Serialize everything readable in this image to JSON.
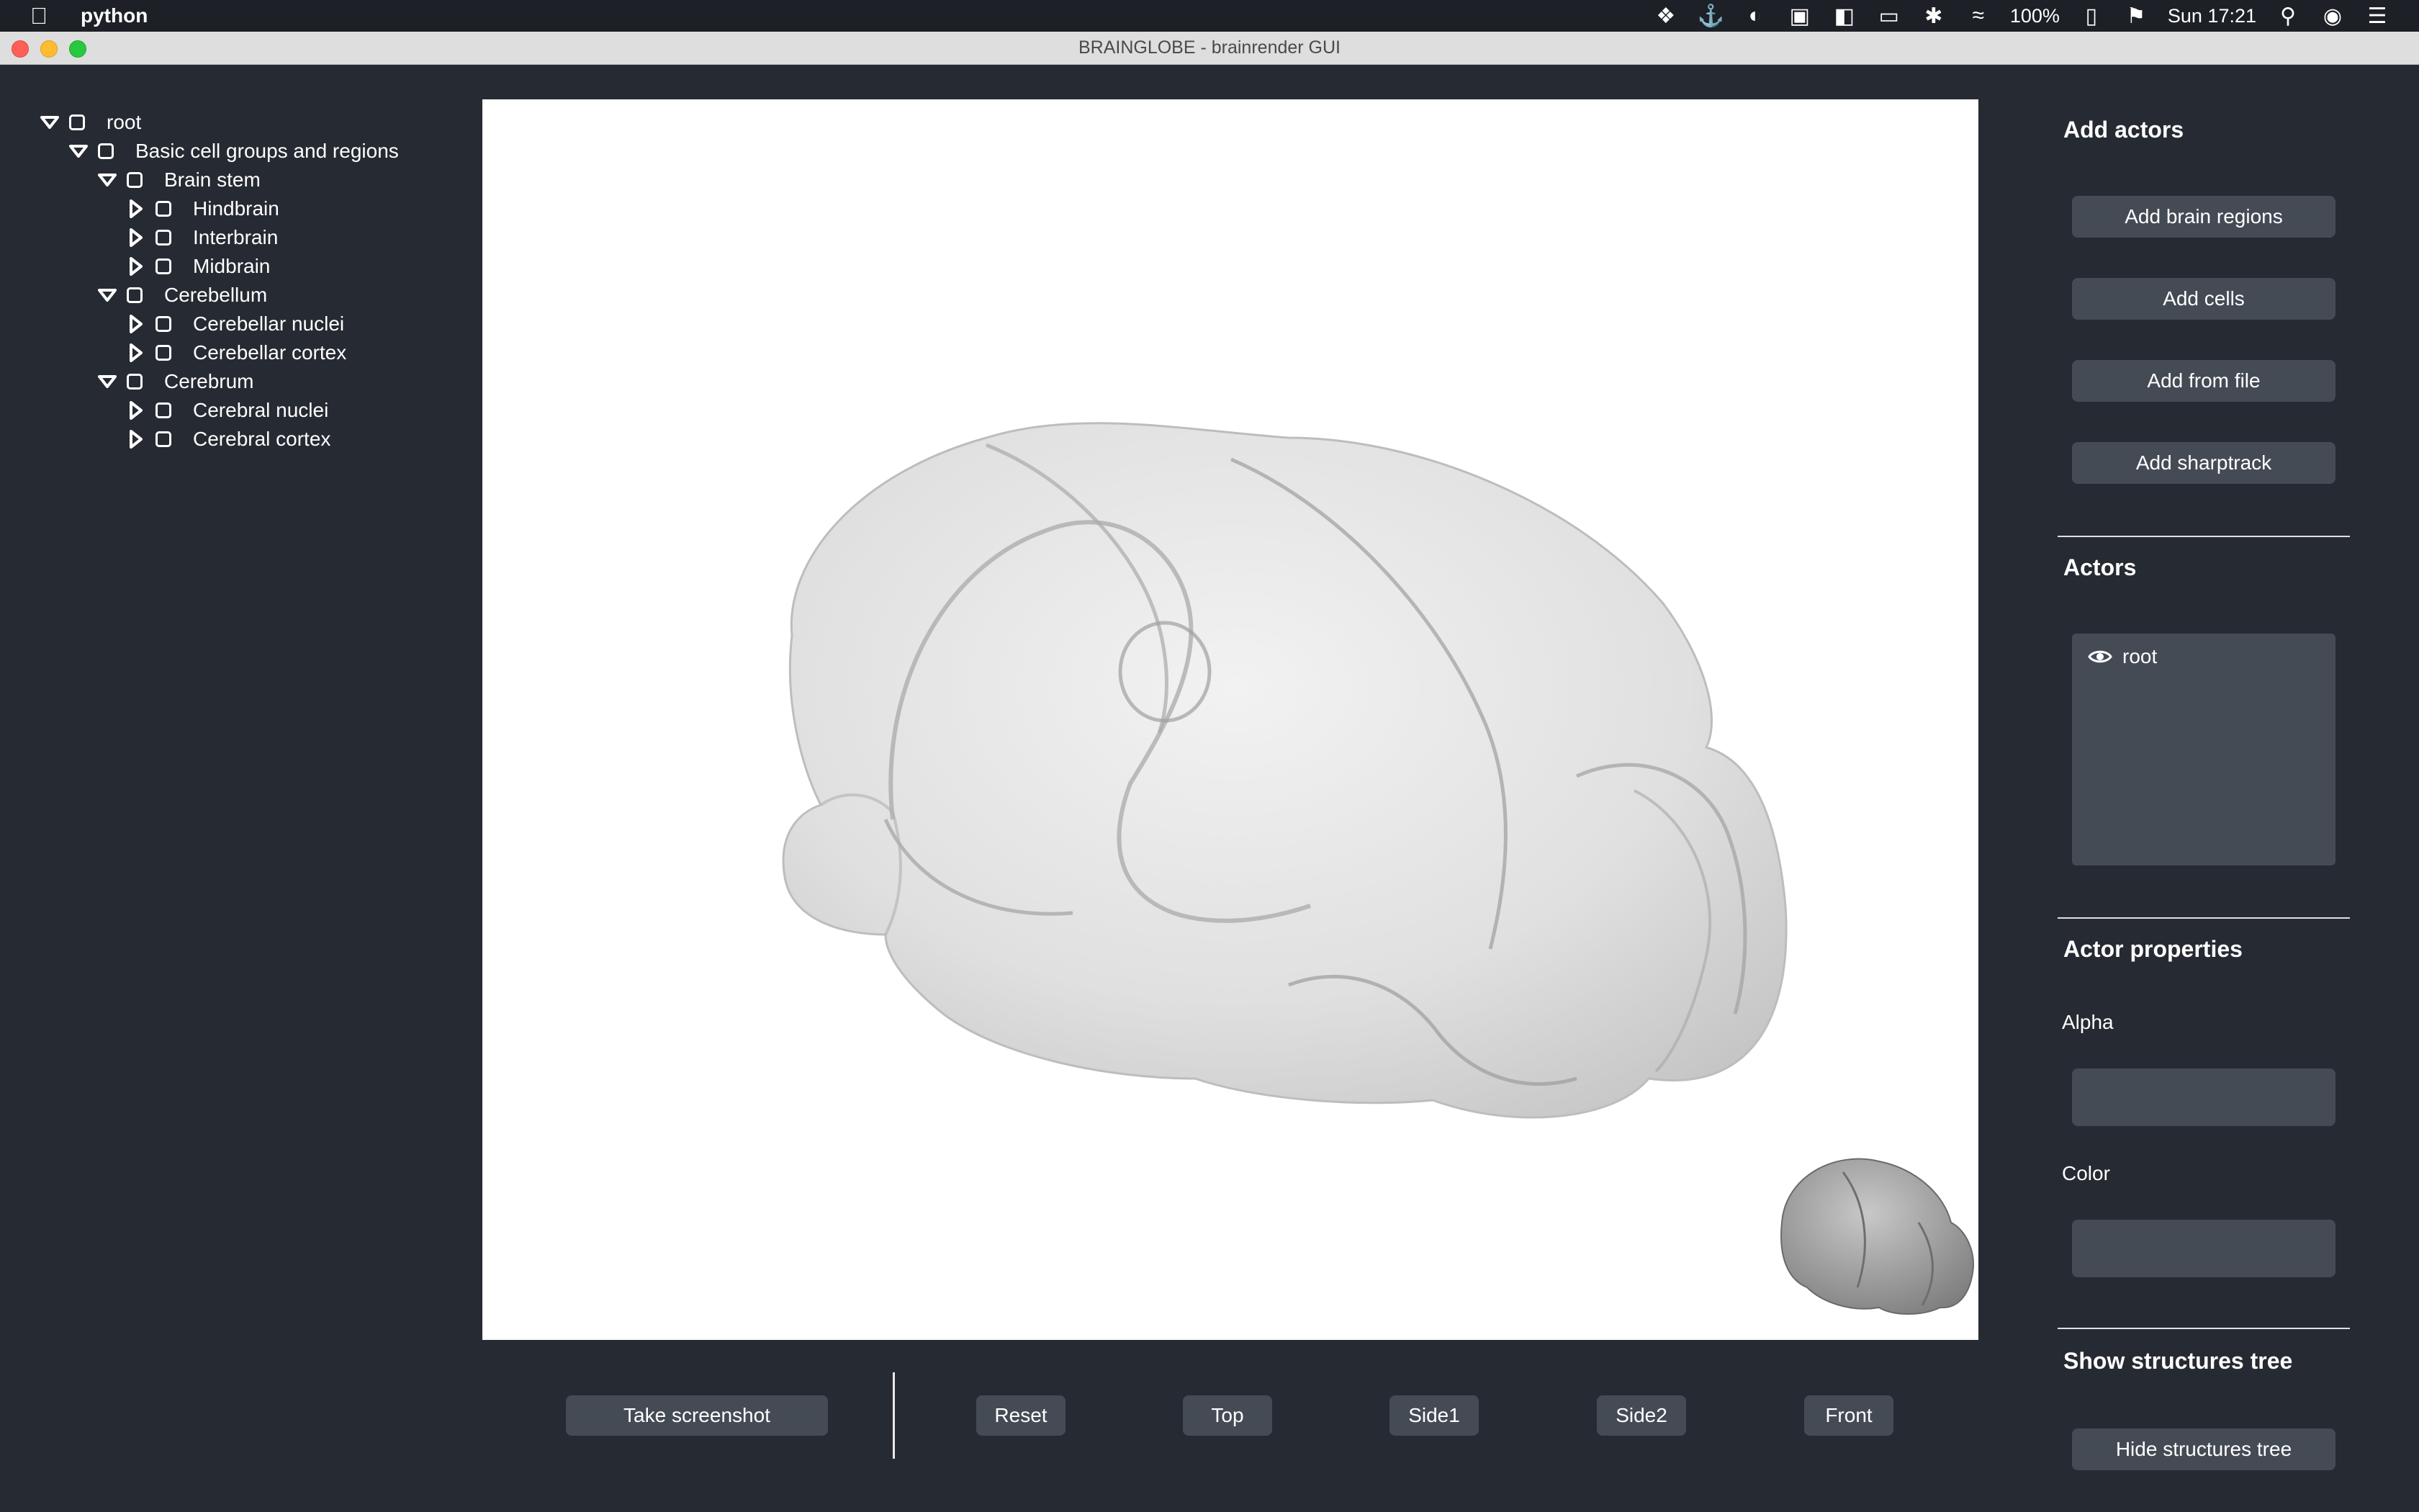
{
  "menubar": {
    "app_name": "python",
    "battery": "100%",
    "clock": "Sun 17:21"
  },
  "window": {
    "title": "BRAINGLOBE - brainrender GUI"
  },
  "tree": {
    "items": [
      {
        "label": "root",
        "expanded": true
      },
      {
        "label": "Basic cell groups and regions",
        "expanded": true
      },
      {
        "label": "Brain stem",
        "expanded": true
      },
      {
        "label": "Hindbrain",
        "expanded": false
      },
      {
        "label": "Interbrain",
        "expanded": false
      },
      {
        "label": "Midbrain",
        "expanded": false
      },
      {
        "label": "Cerebellum",
        "expanded": true
      },
      {
        "label": "Cerebellar nuclei",
        "expanded": false
      },
      {
        "label": "Cerebellar cortex",
        "expanded": false
      },
      {
        "label": "Cerebrum",
        "expanded": true
      },
      {
        "label": "Cerebral nuclei",
        "expanded": false
      },
      {
        "label": "Cerebral cortex",
        "expanded": false
      }
    ]
  },
  "bottom": {
    "screenshot": "Take screenshot",
    "reset": "Reset",
    "top": "Top",
    "side1": "Side1",
    "side2": "Side2",
    "front": "Front"
  },
  "right": {
    "add_actors_title": "Add actors",
    "add_brain_regions": "Add brain regions",
    "add_cells": "Add cells",
    "add_from_file": "Add from file",
    "add_sharptrack": "Add sharptrack",
    "actors_title": "Actors",
    "actors": [
      {
        "name": "root",
        "visible": true
      }
    ],
    "actor_properties_title": "Actor properties",
    "alpha_label": "Alpha",
    "alpha_value": "",
    "color_label": "Color",
    "color_value": "",
    "show_tree_title": "Show structures tree",
    "hide_tree_button": "Hide structures tree"
  },
  "colors": {
    "background": "#262a32",
    "button": "#454b55",
    "viewport": "#ffffff",
    "brain_mesh": "#d6d6d6"
  }
}
